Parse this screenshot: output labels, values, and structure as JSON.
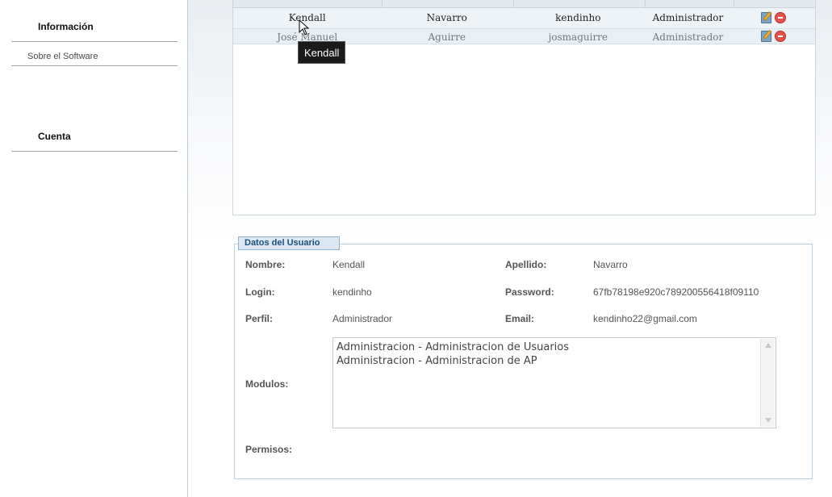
{
  "sidebar": {
    "info_heading": "Información",
    "about_label": "Sobre el Software",
    "account_heading": "Cuenta"
  },
  "grid": {
    "rows": [
      {
        "nombre": "Kendall",
        "apellido": "Navarro",
        "login": "kendinho",
        "perfil": "Administrador"
      },
      {
        "nombre": "José Manuel",
        "apellido": "Aguirre",
        "login": "josmaguirre",
        "perfil": "Administrador"
      }
    ],
    "tooltip": "Kendall"
  },
  "details": {
    "legend": "Datos del Usuario",
    "nombre_label": "Nombre:",
    "nombre_value": "Kendall",
    "apellido_label": "Apellido:",
    "apellido_value": "Navarro",
    "login_label": "Login:",
    "login_value": "kendinho",
    "password_label": "Password:",
    "password_value": "67fb78198e920c789200556418f09110",
    "perfil_label": "Perfil:",
    "perfil_value": "Administrador",
    "email_label": "Email:",
    "email_value": "kendinho22@gmail.com",
    "modulos_label": "Modulos:",
    "modulos": [
      "Administracion - Administracion de Usuarios",
      "Administracion - Administracion de AP"
    ],
    "permisos_label": "Permisos:"
  },
  "icons": {
    "edit": "edit-icon",
    "delete": "delete-icon",
    "cursor": "cursor-icon"
  }
}
